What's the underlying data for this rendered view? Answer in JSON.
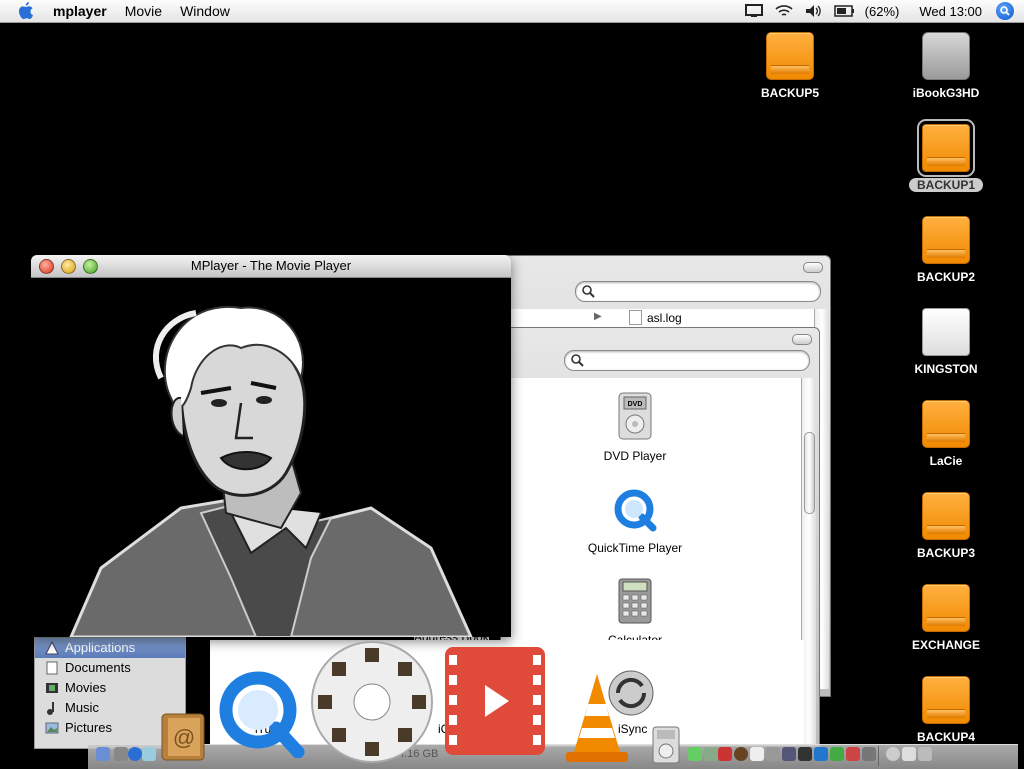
{
  "menubar": {
    "app_name": "mplayer",
    "menus": [
      "Movie",
      "Window"
    ],
    "battery_percent": "(62%)",
    "clock": "Wed 13:00"
  },
  "desktop": {
    "drives": [
      {
        "label": "BACKUP5",
        "kind": "firewire"
      },
      {
        "label": "iBookG3HD",
        "kind": "hard-disk"
      },
      {
        "label": "BACKUP1",
        "kind": "firewire",
        "selected": true
      },
      {
        "label": "BACKUP2",
        "kind": "firewire"
      },
      {
        "label": "KINGSTON",
        "kind": "usb"
      },
      {
        "label": "LaCie",
        "kind": "firewire"
      },
      {
        "label": "BACKUP3",
        "kind": "firewire"
      },
      {
        "label": "EXCHANGE",
        "kind": "firewire"
      },
      {
        "label": "BACKUP4",
        "kind": "firewire"
      }
    ]
  },
  "mplayer_window": {
    "title": "MPlayer - The Movie Player"
  },
  "finder_back": {
    "file_row": "asl.log"
  },
  "finder_front": {
    "apps": [
      "DVD Player",
      "QuickTime Player",
      "Calculator"
    ],
    "partial_labels": [
      "Sherlock",
      "Address Book",
      "iTun",
      "iCh",
      "iSync"
    ],
    "status_text": "4.16 GB"
  },
  "sidebar": {
    "items": [
      "Applications",
      "Documents",
      "Movies",
      "Music",
      "Pictures"
    ]
  },
  "colors": {
    "firewire_orange": "#f08a00",
    "selection_blue": "#5a7ab8",
    "dock_video_red": "#e04a3a"
  }
}
